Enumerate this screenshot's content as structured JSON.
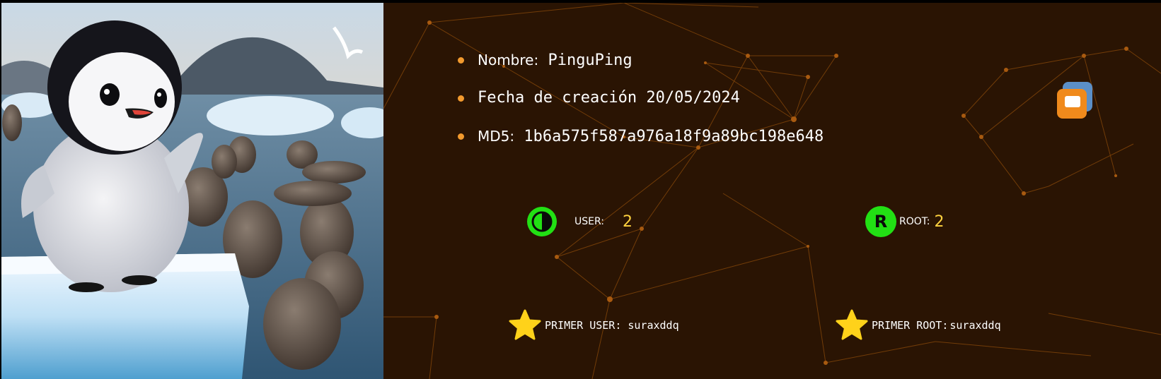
{
  "machine": {
    "name_label": "Nombre:",
    "name_value": "PinguPing",
    "date_label": "Fecha de creación",
    "date_value": "20/05/2024",
    "md5_label": "MD5:",
    "md5_value": "1b6a575f587a976a18f9a89bc198e648"
  },
  "stats": {
    "user_label": "USER:",
    "user_value": "2",
    "root_label": "ROOT:",
    "root_value": "2",
    "root_icon_letter": "R"
  },
  "first_bloods": {
    "user_label": "PRIMER USER:",
    "user_value": "suraxddq",
    "root_label": "PRIMER ROOT:",
    "root_value": "suraxddq"
  },
  "icons": {
    "user_icon": "half-circle-icon",
    "root_icon": "r-circle-icon",
    "star_icon": "star-icon",
    "platform_icon": "virtualbox-icon",
    "artwork": "penguin-on-ice-with-seals-illustration"
  },
  "colors": {
    "panel_bg": "#2a1403",
    "accent_orange": "#f29a2e",
    "stat_green": "#22e014",
    "number_yellow": "#ffd23f",
    "star_yellow": "#ffd21a"
  }
}
